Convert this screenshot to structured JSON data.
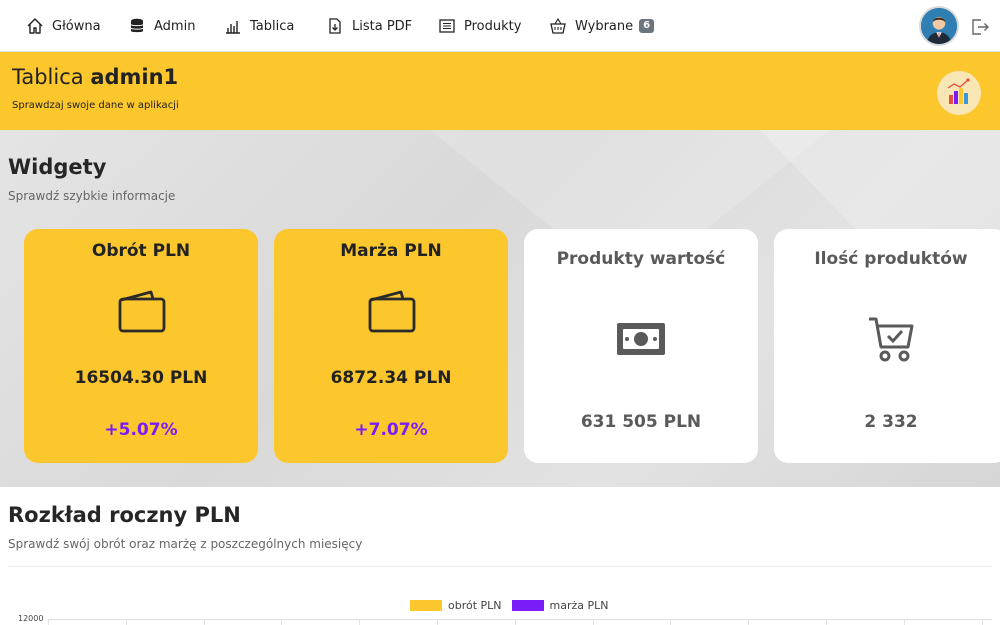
{
  "nav": {
    "items": [
      {
        "label": "Główna",
        "icon": "home-icon"
      },
      {
        "label": "Admin",
        "icon": "database-icon"
      },
      {
        "label": "Tablica",
        "icon": "bar-chart-icon"
      },
      {
        "label": "Lista PDF",
        "icon": "file-download-icon"
      },
      {
        "label": "Produkty",
        "icon": "list-icon"
      },
      {
        "label": "Wybrane",
        "icon": "basket-icon",
        "badge": "6"
      }
    ],
    "avatar_icon": "user-avatar-icon",
    "logout_icon": "logout-icon"
  },
  "header": {
    "title_prefix": "Tablica",
    "title_user": "admin1",
    "subtitle": "Sprawdzaj swoje dane w aplikacji",
    "icon": "analytics-icon"
  },
  "widgets": {
    "title": "Widgety",
    "subtitle": "Sprawdź szybkie informacje",
    "cards": [
      {
        "title": "Obrót PLN",
        "icon": "wallet-icon",
        "value": "16504.30 PLN",
        "change": "+5.07%"
      },
      {
        "title": "Marża PLN",
        "icon": "wallet-icon",
        "value": "6872.34 PLN",
        "change": "+7.07%"
      },
      {
        "title": "Produkty wartość",
        "icon": "money-icon",
        "value": "631 505 PLN"
      },
      {
        "title": "Ilość produktów",
        "icon": "cart-check-icon",
        "value": "2 332"
      }
    ]
  },
  "annual": {
    "title": "Rozkład roczny PLN",
    "subtitle": "Sprawdź swój obrót oraz marżę z poszczególnych miesięcy"
  },
  "colors": {
    "accent_yellow": "#fcc72c",
    "accent_purple": "#7a1cf7"
  },
  "chart_data": {
    "type": "bar",
    "series": [
      {
        "name": "obrót PLN",
        "color": "#fcc72c"
      },
      {
        "name": "marża PLN",
        "color": "#7a1cf7"
      }
    ],
    "y_ticks": [
      "12000"
    ]
  }
}
